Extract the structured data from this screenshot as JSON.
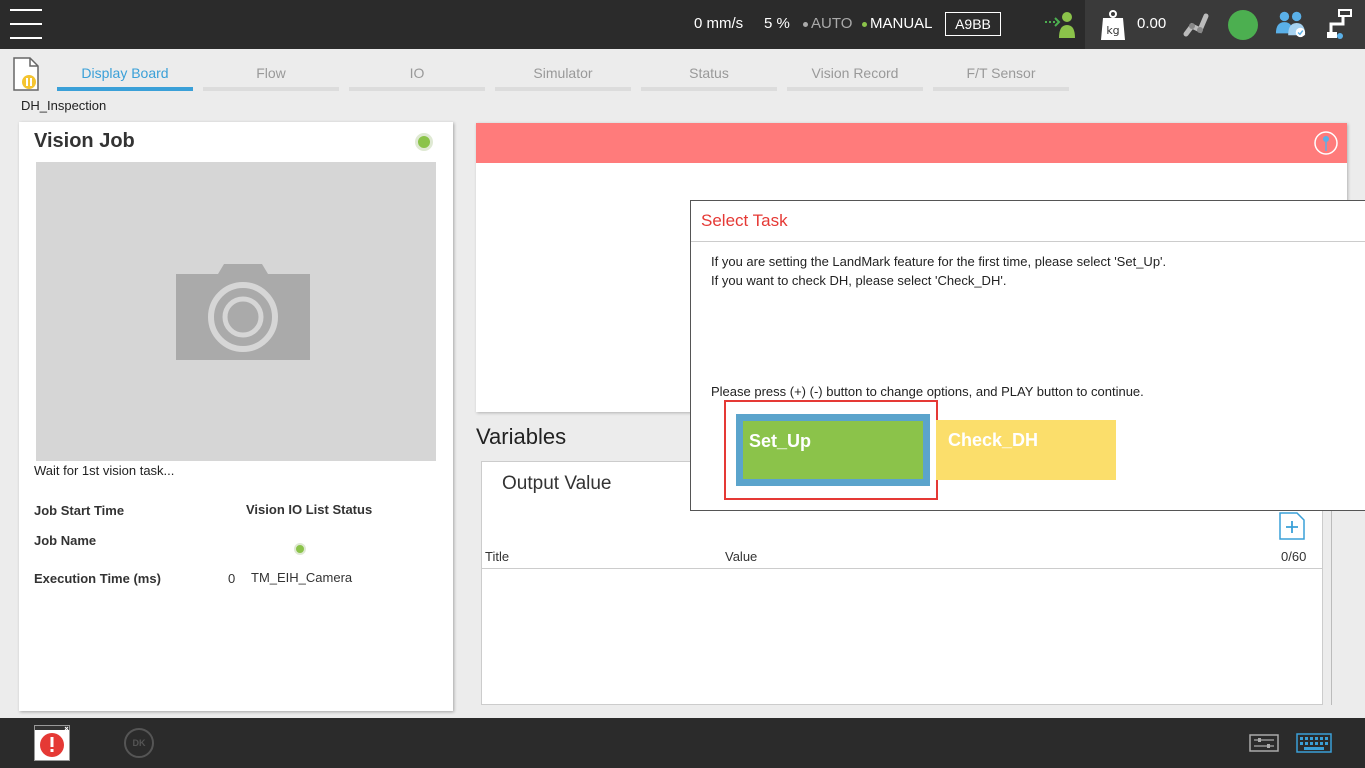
{
  "topbar": {
    "speed": "0 mm/s",
    "percent": "5 %",
    "mode_auto": "AUTO",
    "mode_manual": "MANUAL",
    "robot_id": "A9BB",
    "payload": "0.00",
    "icons": [
      "menu-icon",
      "user-login-icon",
      "payload-kg-icon",
      "robot-arm-icon",
      "status-circle-icon",
      "users-icon",
      "robot-settings-icon"
    ],
    "colors": {
      "bar": "#2b2b2b",
      "active_mode_dot": "#8bc34a",
      "status": "#4caf50"
    }
  },
  "tabs": [
    {
      "label": "Display Board",
      "active": true
    },
    {
      "label": "Flow",
      "active": false
    },
    {
      "label": "IO",
      "active": false
    },
    {
      "label": "Simulator",
      "active": false
    },
    {
      "label": "Status",
      "active": false
    },
    {
      "label": "Vision Record",
      "active": false
    },
    {
      "label": "F/T Sensor",
      "active": false
    }
  ],
  "flow_name": "DH_Inspection",
  "vision_job": {
    "title": "Vision Job",
    "wait_text": "Wait for 1st vision task...",
    "job_start_time_label": "Job Start Time",
    "vision_io_label": "Vision IO List Status",
    "job_name_label": "Job Name",
    "execution_time_label": "Execution Time (ms)",
    "execution_time_value": "0",
    "camera_name": "TM_EIH_Camera"
  },
  "variables": {
    "title": "Variables",
    "subtitle": "Output Value",
    "col_title": "Title",
    "col_value": "Value",
    "count": "0/60"
  },
  "dialog": {
    "title": "Select Task",
    "line1": "If you are setting the LandMark feature for the first time, please select 'Set_Up'.",
    "line2": "If you want to check DH, please select 'Check_DH'.",
    "instruction": "Please press (+) (-) button to change options, and PLAY button to continue.",
    "options": [
      {
        "label": "Set_Up",
        "selected": true,
        "color": "#8bc34a"
      },
      {
        "label": "Check_DH",
        "selected": false,
        "color": "#fbde6b"
      }
    ]
  },
  "bottombar": {
    "dk_label": "DK",
    "icons": [
      "error-alert-icon",
      "dk-icon",
      "controller-settings-icon",
      "keyboard-icon"
    ]
  }
}
